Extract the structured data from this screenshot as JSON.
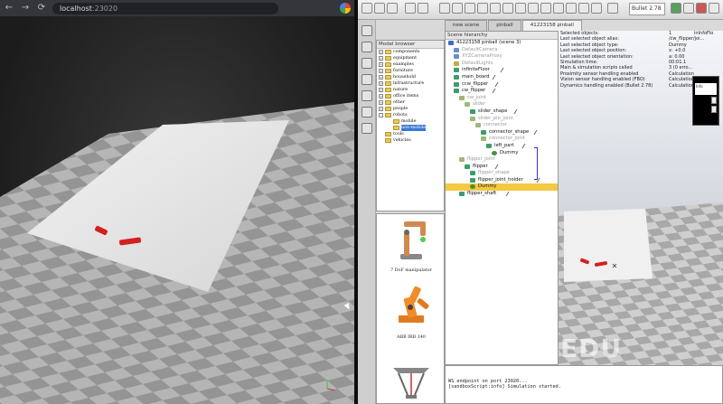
{
  "browser": {
    "nav": {
      "back": "←",
      "forward": "→",
      "reload": "⟳"
    },
    "url_host": "localhost",
    "url_port": ":23020",
    "extension_icon": "chrome-profile-icon"
  },
  "app": {
    "tabs": [
      {
        "label": "new scene",
        "active": false
      },
      {
        "label": "pinball",
        "active": false
      },
      {
        "label": "41223158 pinball",
        "active": true
      }
    ],
    "toolbar_combo": "Bullet 2.78",
    "model_browser": {
      "title": "Model browser",
      "items": [
        {
          "label": "components",
          "indent": 0,
          "expand": "+"
        },
        {
          "label": "equipment",
          "indent": 0,
          "expand": "+"
        },
        {
          "label": "examples",
          "indent": 0,
          "expand": "+"
        },
        {
          "label": "furniture",
          "indent": 0,
          "expand": "+"
        },
        {
          "label": "household",
          "indent": 0,
          "expand": "+"
        },
        {
          "label": "infrastructure",
          "indent": 0,
          "expand": "+"
        },
        {
          "label": "nature",
          "indent": 0,
          "expand": "+"
        },
        {
          "label": "office items",
          "indent": 0,
          "expand": "+"
        },
        {
          "label": "other",
          "indent": 0,
          "expand": "+"
        },
        {
          "label": "people",
          "indent": 0,
          "expand": "+"
        },
        {
          "label": "robots",
          "indent": 0,
          "expand": "-"
        },
        {
          "label": "mobile",
          "indent": 1,
          "expand": ""
        },
        {
          "label": "non-mobile",
          "indent": 1,
          "expand": "",
          "selected": true
        },
        {
          "label": "tools",
          "indent": 0,
          "expand": ""
        },
        {
          "label": "vehicles",
          "indent": 0,
          "expand": ""
        }
      ]
    },
    "model_thumbs": [
      {
        "label": "7 DoF manipulator"
      },
      {
        "label": "ABB IRB 140"
      }
    ],
    "scene_hierarchy": {
      "title": "Scene hierarchy",
      "rows": [
        {
          "label": "41223158 pinball (scene 3)",
          "indent": 0,
          "icon": "scene",
          "dim": false
        },
        {
          "label": "DefaultCamera",
          "indent": 1,
          "icon": "camera",
          "dim": true
        },
        {
          "label": "XYZCameraProxy",
          "indent": 1,
          "icon": "camera",
          "dim": true
        },
        {
          "label": "DefaultLights",
          "indent": 1,
          "icon": "light",
          "dim": true
        },
        {
          "label": "infiniteFloor",
          "indent": 1,
          "icon": "shape",
          "dim": false
        },
        {
          "label": "main_board",
          "indent": 1,
          "icon": "shape",
          "dim": false
        },
        {
          "label": "ccw_flipper",
          "indent": 1,
          "icon": "shape",
          "dim": false
        },
        {
          "label": "cw_flipper",
          "indent": 1,
          "icon": "shape",
          "dim": false
        },
        {
          "label": "cw_joint",
          "indent": 2,
          "icon": "joint",
          "dim": true
        },
        {
          "label": "slider",
          "indent": 3,
          "icon": "joint",
          "dim": true
        },
        {
          "label": "slider_shape",
          "indent": 4,
          "icon": "shape",
          "dim": false
        },
        {
          "label": "slider_pin_joint",
          "indent": 4,
          "icon": "joint",
          "dim": true
        },
        {
          "label": "connector",
          "indent": 5,
          "icon": "joint",
          "dim": true
        },
        {
          "label": "connector_shape",
          "indent": 6,
          "icon": "shape",
          "dim": false
        },
        {
          "label": "connector_joint",
          "indent": 6,
          "icon": "joint",
          "dim": true
        },
        {
          "label": "left_part",
          "indent": 7,
          "icon": "shape",
          "dim": false
        },
        {
          "label": "Dummy",
          "indent": 8,
          "icon": "dummy",
          "dim": false
        },
        {
          "label": "flipper_joint",
          "indent": 2,
          "icon": "joint",
          "dim": true
        },
        {
          "label": "flipper",
          "indent": 3,
          "icon": "shape",
          "dim": false
        },
        {
          "label": "flipper_shape",
          "indent": 4,
          "icon": "shape",
          "dim": true
        },
        {
          "label": "flipper_joint_holder",
          "indent": 4,
          "icon": "shape",
          "dim": false
        },
        {
          "label": "Dummy",
          "indent": 4,
          "icon": "dummy",
          "dim": false,
          "highlight": true
        },
        {
          "label": "flipper_shaft",
          "indent": 2,
          "icon": "shape",
          "dim": false
        }
      ]
    },
    "info": {
      "rows": [
        {
          "label": "Selected objects:",
          "value": "1"
        },
        {
          "label": "Last selected object alias:",
          "value": "/cw_flipper/joi..."
        },
        {
          "label": "Last selected object type:",
          "value": "Dummy"
        },
        {
          "label": "Last selected object position:",
          "value": "x: +0.0"
        },
        {
          "label": "Last selected object orientation:",
          "value": "a: 0.00"
        },
        {
          "label": "Simulation time:",
          "value": "00:01.1"
        },
        {
          "label": "Main & simulation scripts called",
          "value": "3 (0 erro..."
        },
        {
          "label": "Proximity sensor handling enabled",
          "value": "Calculation"
        },
        {
          "label": "Vision sensor handling enabled (FBO)",
          "value": "Calculation"
        },
        {
          "label": "Dynamics handling enabled (Bullet 2.78)",
          "value": "Calculation"
        }
      ],
      "corner_label": "inInfoFlo"
    },
    "mini_window_text": "Info",
    "watermark": "EDU",
    "console": [
      "WS endpoint on port 23020...",
      "[sandboxScript:info]  Simulation started."
    ]
  },
  "colors": {
    "highlight": "#f5c842",
    "selection": "#3b78d8",
    "bracket": "#3b2fc2",
    "flipper_red": "#d42020"
  }
}
